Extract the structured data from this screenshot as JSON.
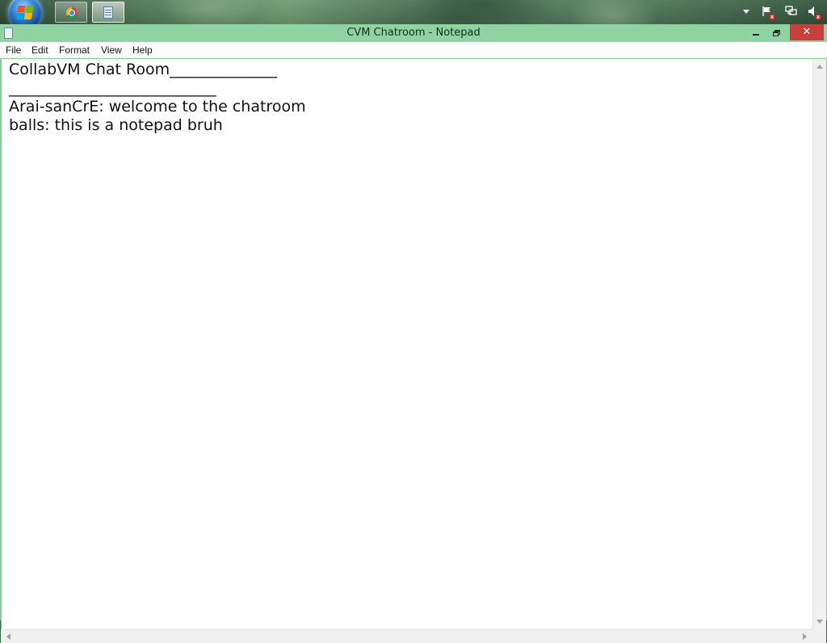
{
  "taskbar": {
    "start_icon": "windows-start-orb",
    "pinned": [
      {
        "name": "Google Chrome",
        "icon": "chrome-icon"
      },
      {
        "name": "Notepad",
        "icon": "notepad-icon",
        "active": true
      }
    ],
    "tray": {
      "icons": [
        "tray-overflow-arrow",
        "action-center-flag-icon",
        "network-icon",
        "volume-muted-icon"
      ],
      "status_badge": "x"
    }
  },
  "window": {
    "title": "CVM Chatroom - Notepad",
    "controls": {
      "close_glyph": "✕"
    },
    "accent_color": "#8fd3a3",
    "close_color": "#c7413a"
  },
  "menu": {
    "file": "File",
    "edit": "Edit",
    "format": "Format",
    "view": "View",
    "help": "Help"
  },
  "document": {
    "text": "CollabVM Chat Room______________\n___________________________\nArai-sanCrE: welcome to the chatroom\nballs: this is a notepad bruh"
  }
}
